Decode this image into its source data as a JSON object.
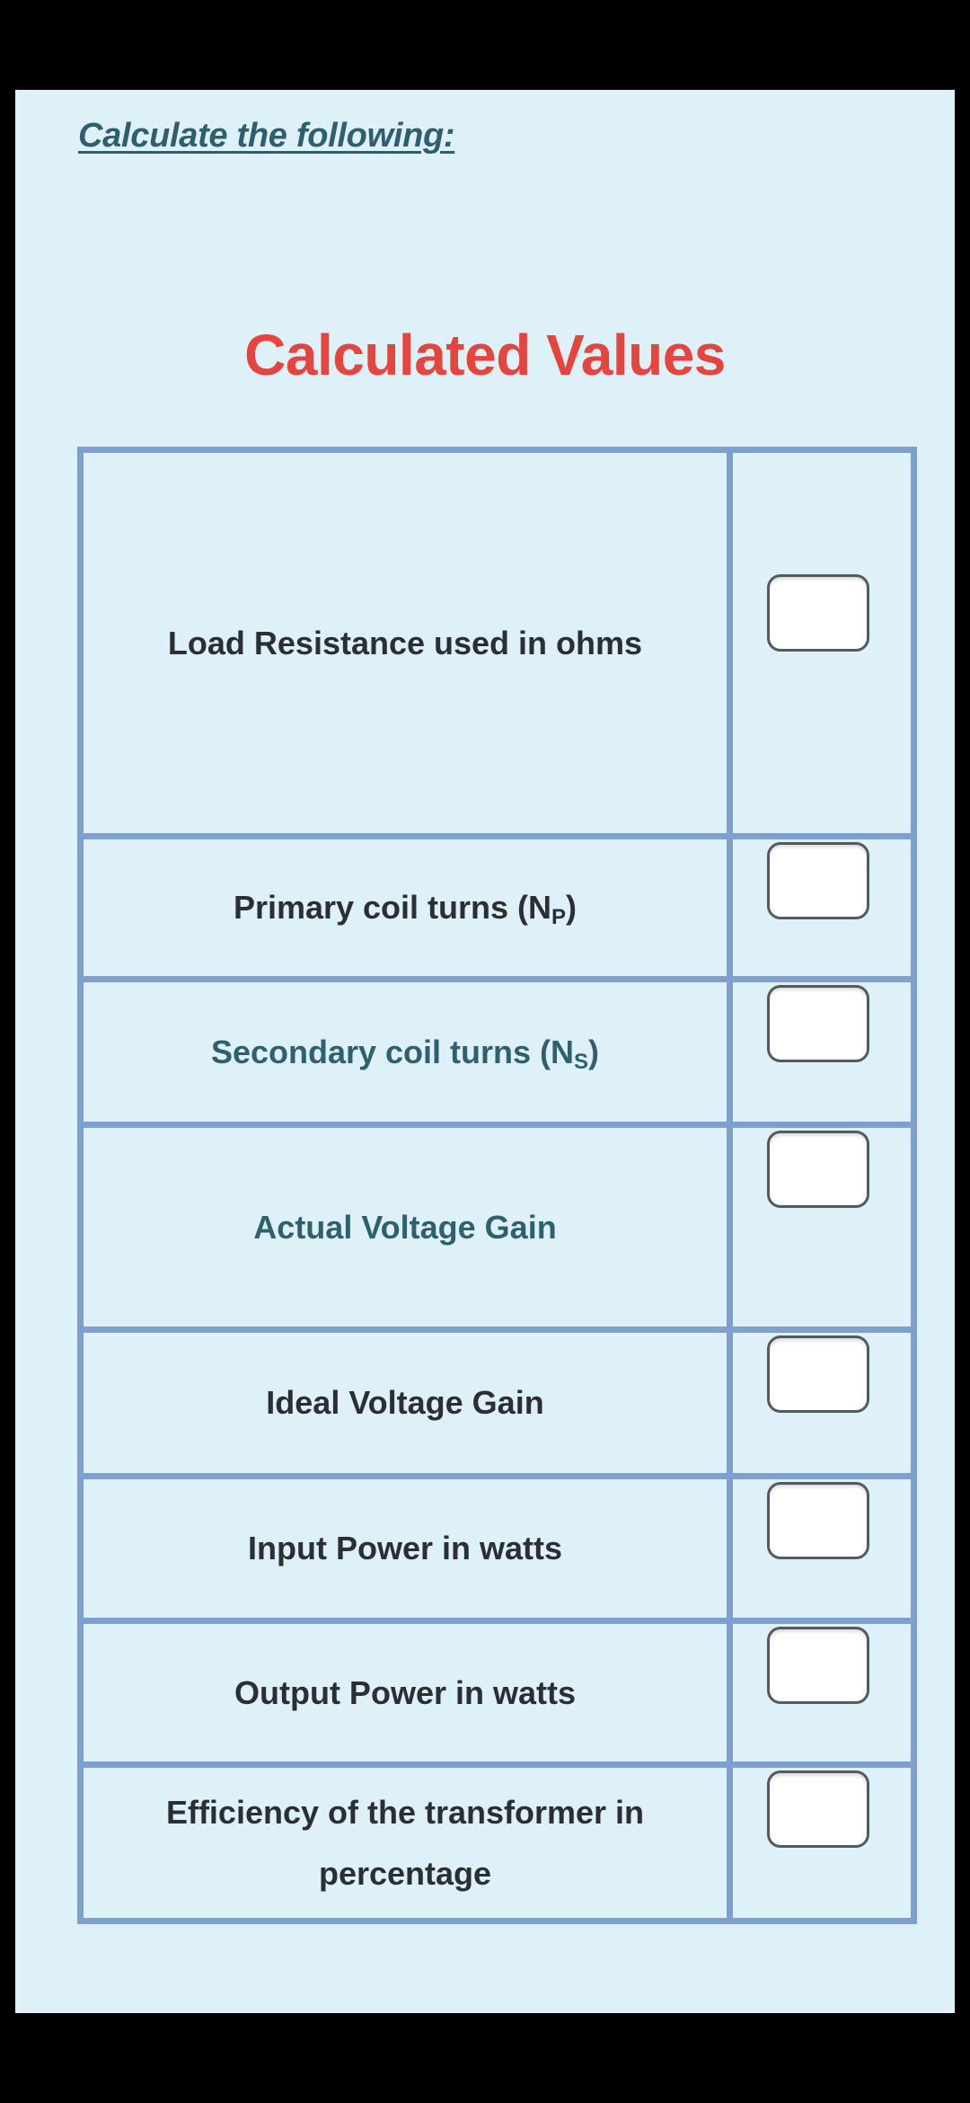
{
  "instruction": "Calculate the following:",
  "section_title": "Calculated Values",
  "colors": {
    "panel_background": "#dff1f8",
    "title_red": "#e5443f",
    "table_border": "#7f9fcf",
    "label_dark": "#2b2f33",
    "label_teal": "#2f6070"
  },
  "rows": [
    {
      "label": "Load Resistance used in ohms",
      "subscript": "",
      "suffix": "",
      "value": ""
    },
    {
      "label": "Primary coil turns (N",
      "subscript": "P",
      "suffix": ")",
      "value": ""
    },
    {
      "label": "Secondary coil turns (N",
      "subscript": "S",
      "suffix": ")",
      "value": ""
    },
    {
      "label": "Actual Voltage Gain",
      "subscript": "",
      "suffix": "",
      "value": ""
    },
    {
      "label": "Ideal Voltage Gain",
      "subscript": "",
      "suffix": "",
      "value": ""
    },
    {
      "label": "Input Power in watts",
      "subscript": "",
      "suffix": "",
      "value": ""
    },
    {
      "label": "Output Power in watts",
      "subscript": "",
      "suffix": "",
      "value": ""
    },
    {
      "label": "Efficiency of the transformer in percentage",
      "subscript": "",
      "suffix": "",
      "value": ""
    }
  ]
}
